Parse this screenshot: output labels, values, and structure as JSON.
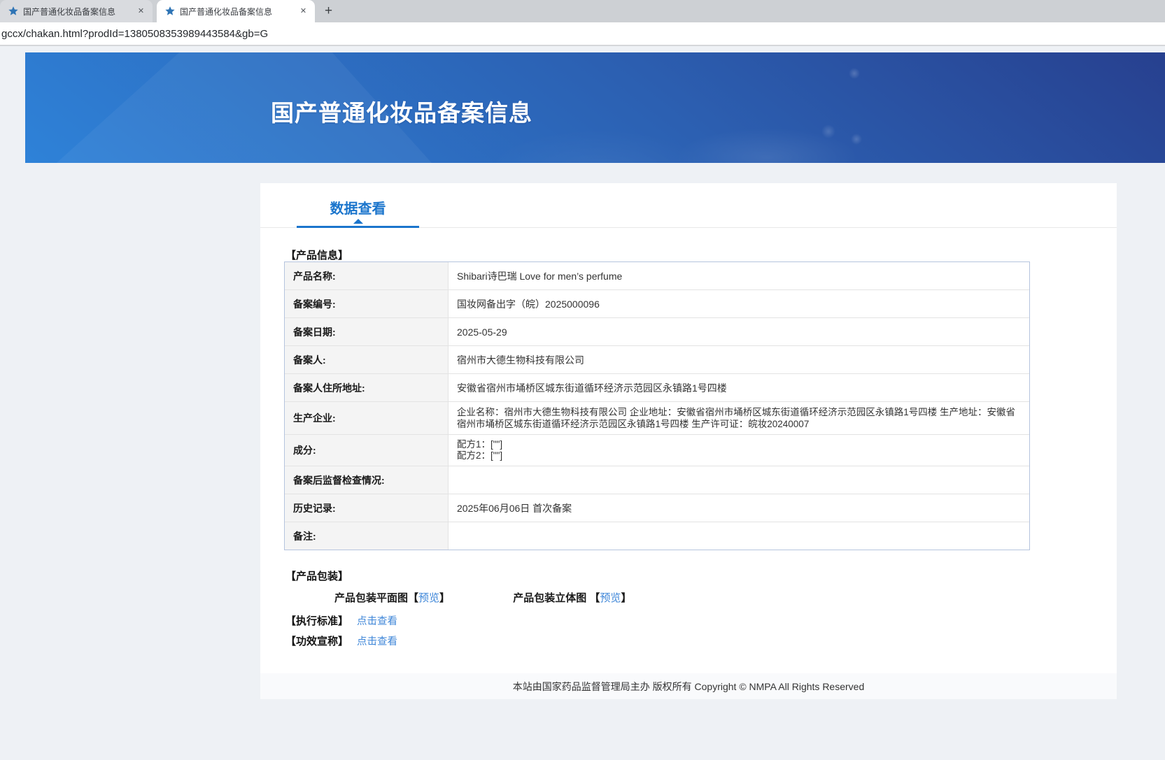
{
  "colors": {
    "accent": "#1b75cc",
    "link": "#3e86d8",
    "banner-top": "#27408f",
    "banner-bottom": "#2e82d8"
  },
  "browser": {
    "tabs": [
      {
        "title": "国产普通化妆品备案信息"
      },
      {
        "title": "国产普通化妆品备案信息"
      }
    ],
    "close_glyph": "✕",
    "new_tab_glyph": "+",
    "url": "gccx/chakan.html?prodId=1380508353989443584&gb=G"
  },
  "banner": {
    "title": "国产普通化妆品备案信息"
  },
  "content": {
    "nav_tab": "数据查看",
    "product_info_heading": "【产品信息】",
    "table": {
      "rows": [
        {
          "label": "产品名称:",
          "value": "Shibari诗巴瑞 Love for men’s perfume"
        },
        {
          "label": "备案编号:",
          "value": "国妆网备出字（皖）2025000096"
        },
        {
          "label": "备案日期:",
          "value": "2025-05-29"
        },
        {
          "label": "备案人:",
          "value": "宿州市大德生物科技有限公司"
        },
        {
          "label": "备案人住所地址:",
          "value": "安徽省宿州市埇桥区城东街道循环经济示范园区永镇路1号四楼"
        },
        {
          "label": "生产企业:",
          "value": "企业名称：宿州市大德生物科技有限公司 企业地址：安徽省宿州市埇桥区城东街道循环经济示范园区永镇路1号四楼 生产地址：安徽省宿州市埇桥区城东街道循环经济示范园区永镇路1号四楼 生产许可证：皖妆20240007"
        },
        {
          "label": "成分:",
          "lines": [
            "配方1：[\"\"]",
            "配方2：[\"\"]"
          ]
        },
        {
          "label": "备案后监督检查情况:",
          "value": ""
        },
        {
          "label": "历史记录:",
          "value": "2025年06月06日 首次备案"
        },
        {
          "label": "备注:",
          "value": ""
        }
      ]
    },
    "packaging": {
      "heading": "【产品包装】",
      "items": [
        {
          "name": "产品包装平面图",
          "open": "【",
          "link": "预览",
          "close": "】"
        },
        {
          "name": "产品包装立体图 ",
          "open": "【",
          "link": "预览",
          "close": "】"
        }
      ]
    },
    "extras": [
      {
        "heading": "【执行标准】",
        "link": "点击查看"
      },
      {
        "heading": "【功效宣称】",
        "link": "点击查看"
      }
    ]
  },
  "footer": {
    "text": "本站由国家药品监督管理局主办 版权所有 Copyright © NMPA All Rights Reserved"
  }
}
